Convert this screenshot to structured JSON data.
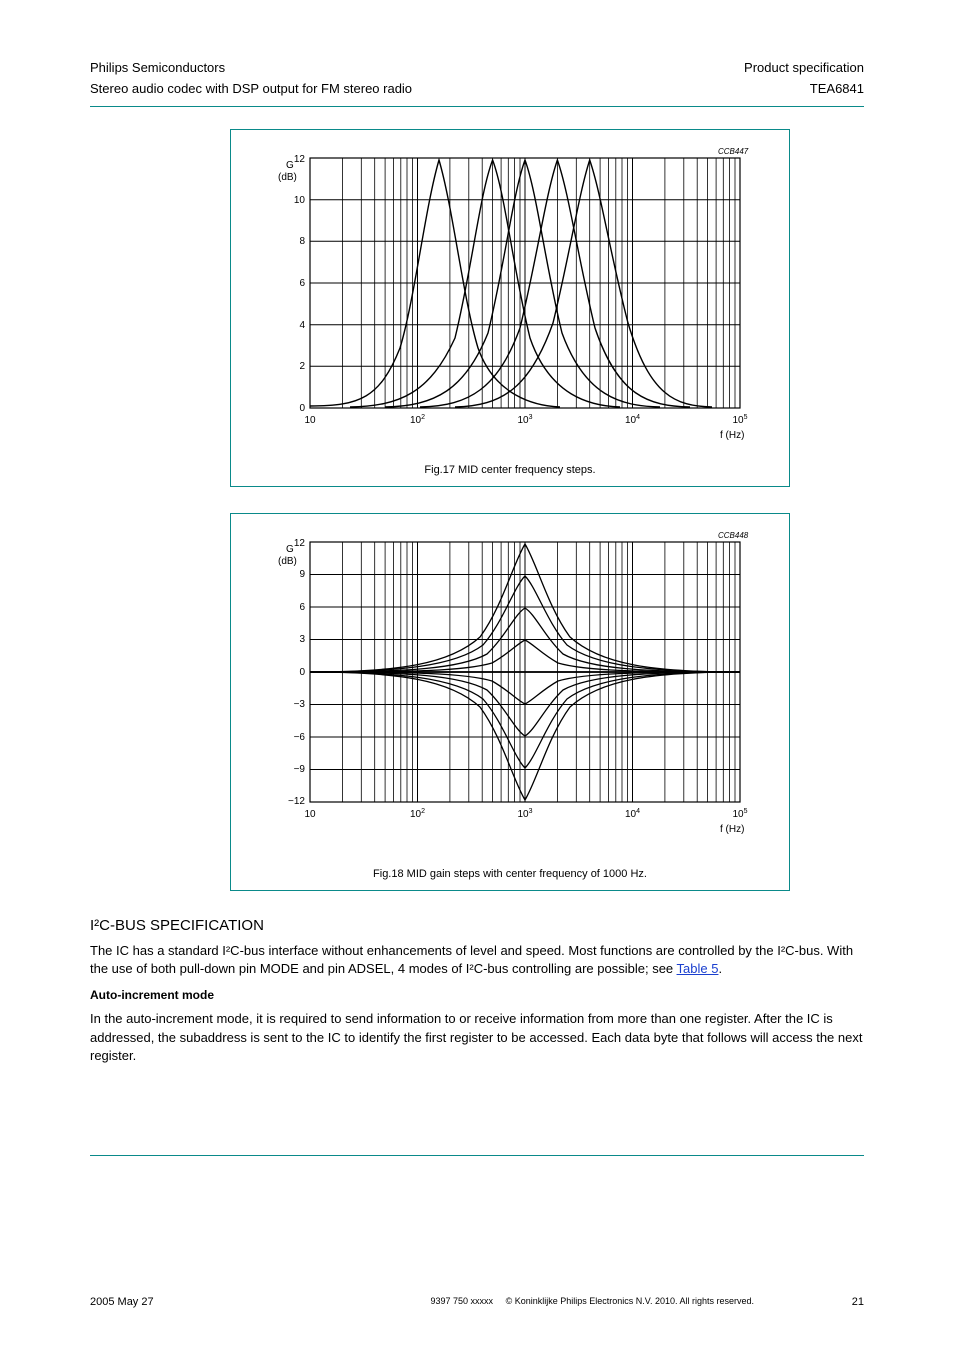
{
  "header": {
    "company": "Philips Semiconductors",
    "doctype": "Product specification",
    "product_line": "Stereo audio codec with DSP output for FM stereo radio",
    "part": "TEA6841"
  },
  "figure17": {
    "label": "Fig.17  MID center frequency steps.",
    "xlabel": "f (Hz)",
    "ylabel": "G (dB)",
    "citation": "CCB447",
    "x_ticks": [
      "10",
      "10²",
      "10³",
      "10⁴",
      "10⁵"
    ],
    "y_ticks": [
      "0",
      "2",
      "4",
      "6",
      "8",
      "10",
      "12"
    ]
  },
  "figure18": {
    "label": "Fig.18  MID gain steps with center frequency of 1000 Hz.",
    "xlabel": "f (Hz)",
    "ylabel": "G (dB)",
    "citation": "CCB448",
    "x_ticks": [
      "10",
      "10²",
      "10³",
      "10⁴",
      "10⁵"
    ],
    "y_ticks": [
      "−12",
      "−9",
      "−6",
      "−3",
      "0",
      "3",
      "6",
      "9",
      "12"
    ]
  },
  "body": {
    "heading": "I²C-BUS SPECIFICATION",
    "para1": "The IC has a standard I²C-bus interface without enhancements of level and speed. Most functions are controlled by the I²C-bus. With the use of both pull-down pin MODE and pin ADSEL, 4 modes of I²C-bus controlling are possible; see ",
    "table_link_text": "Table 5",
    "para1_tail": ".",
    "sub1": "Auto-increment mode",
    "para2": "In the auto-increment mode, it is required to send information to or receive information from more than one register. After the IC is addressed, the subaddress is sent to the IC to identify the first register to be accessed. Each data byte that follows will access the next register."
  },
  "footer": {
    "date": "2005 May 27",
    "page": "21",
    "path": "9397 750 xxxxx",
    "copyright": "© Koninklijke Philips Electronics N.V. 2010. All rights reserved."
  },
  "chart_data": [
    {
      "type": "line",
      "title": "MID center frequency steps",
      "xlabel": "f (Hz)",
      "ylabel": "G (dB)",
      "ylim": [
        0,
        12
      ],
      "xlim": [
        10,
        100000
      ],
      "xscale": "log",
      "series": [
        {
          "name": "160 Hz",
          "center_hz": 160,
          "peak_db": 12
        },
        {
          "name": "500 Hz",
          "center_hz": 500,
          "peak_db": 12
        },
        {
          "name": "1000 Hz",
          "center_hz": 1000,
          "peak_db": 12
        },
        {
          "name": "2000 Hz",
          "center_hz": 2000,
          "peak_db": 12
        },
        {
          "name": "4000 Hz",
          "center_hz": 4000,
          "peak_db": 12
        }
      ]
    },
    {
      "type": "line",
      "title": "MID gain steps with center frequency of 1000 Hz",
      "xlabel": "f (Hz)",
      "ylabel": "G (dB)",
      "ylim": [
        -12,
        12
      ],
      "xlim": [
        10,
        100000
      ],
      "xscale": "log",
      "center_hz": 1000,
      "gain_steps_db": [
        -12,
        -9,
        -6,
        -3,
        0,
        3,
        6,
        9,
        12
      ]
    }
  ]
}
